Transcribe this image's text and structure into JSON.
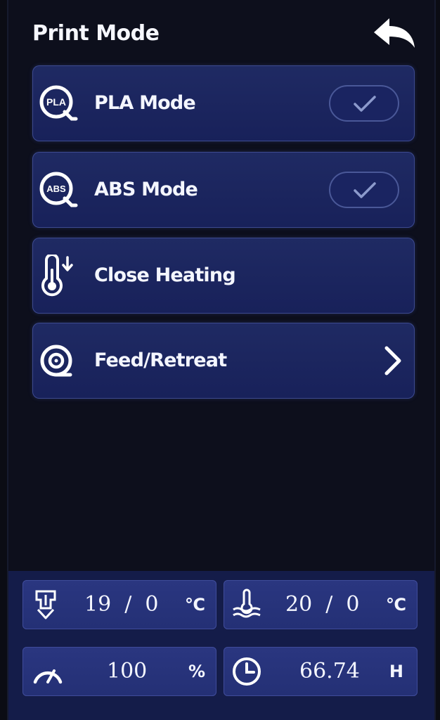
{
  "header": {
    "title": "Print Mode",
    "back_icon": "back-arrow-icon"
  },
  "menu": [
    {
      "label": "PLA Mode",
      "icon": "pla-icon",
      "icon_text": "PLA",
      "control": "toggle",
      "checked": true
    },
    {
      "label": "ABS Mode",
      "icon": "abs-icon",
      "icon_text": "ABS",
      "control": "toggle",
      "checked": true
    },
    {
      "label": "Close Heating",
      "icon": "thermometer-down-icon",
      "control": "none"
    },
    {
      "label": "Feed/Retreat",
      "icon": "filament-spool-icon",
      "control": "chevron"
    }
  ],
  "status": {
    "nozzle": {
      "icon": "nozzle-temp-icon",
      "value": "19  /  0",
      "unit": "℃"
    },
    "bed": {
      "icon": "bed-temp-icon",
      "value": "20  /  0",
      "unit": "℃"
    },
    "speed": {
      "icon": "speed-gauge-icon",
      "value": "100",
      "unit": "%"
    },
    "time": {
      "icon": "clock-icon",
      "value": "66.74",
      "unit": "H"
    }
  },
  "colors": {
    "background": "#0d0f1c",
    "button": "#1f2a63",
    "status_bar": "#141c49",
    "tile": "#2a3680",
    "text": "#ffffff"
  }
}
